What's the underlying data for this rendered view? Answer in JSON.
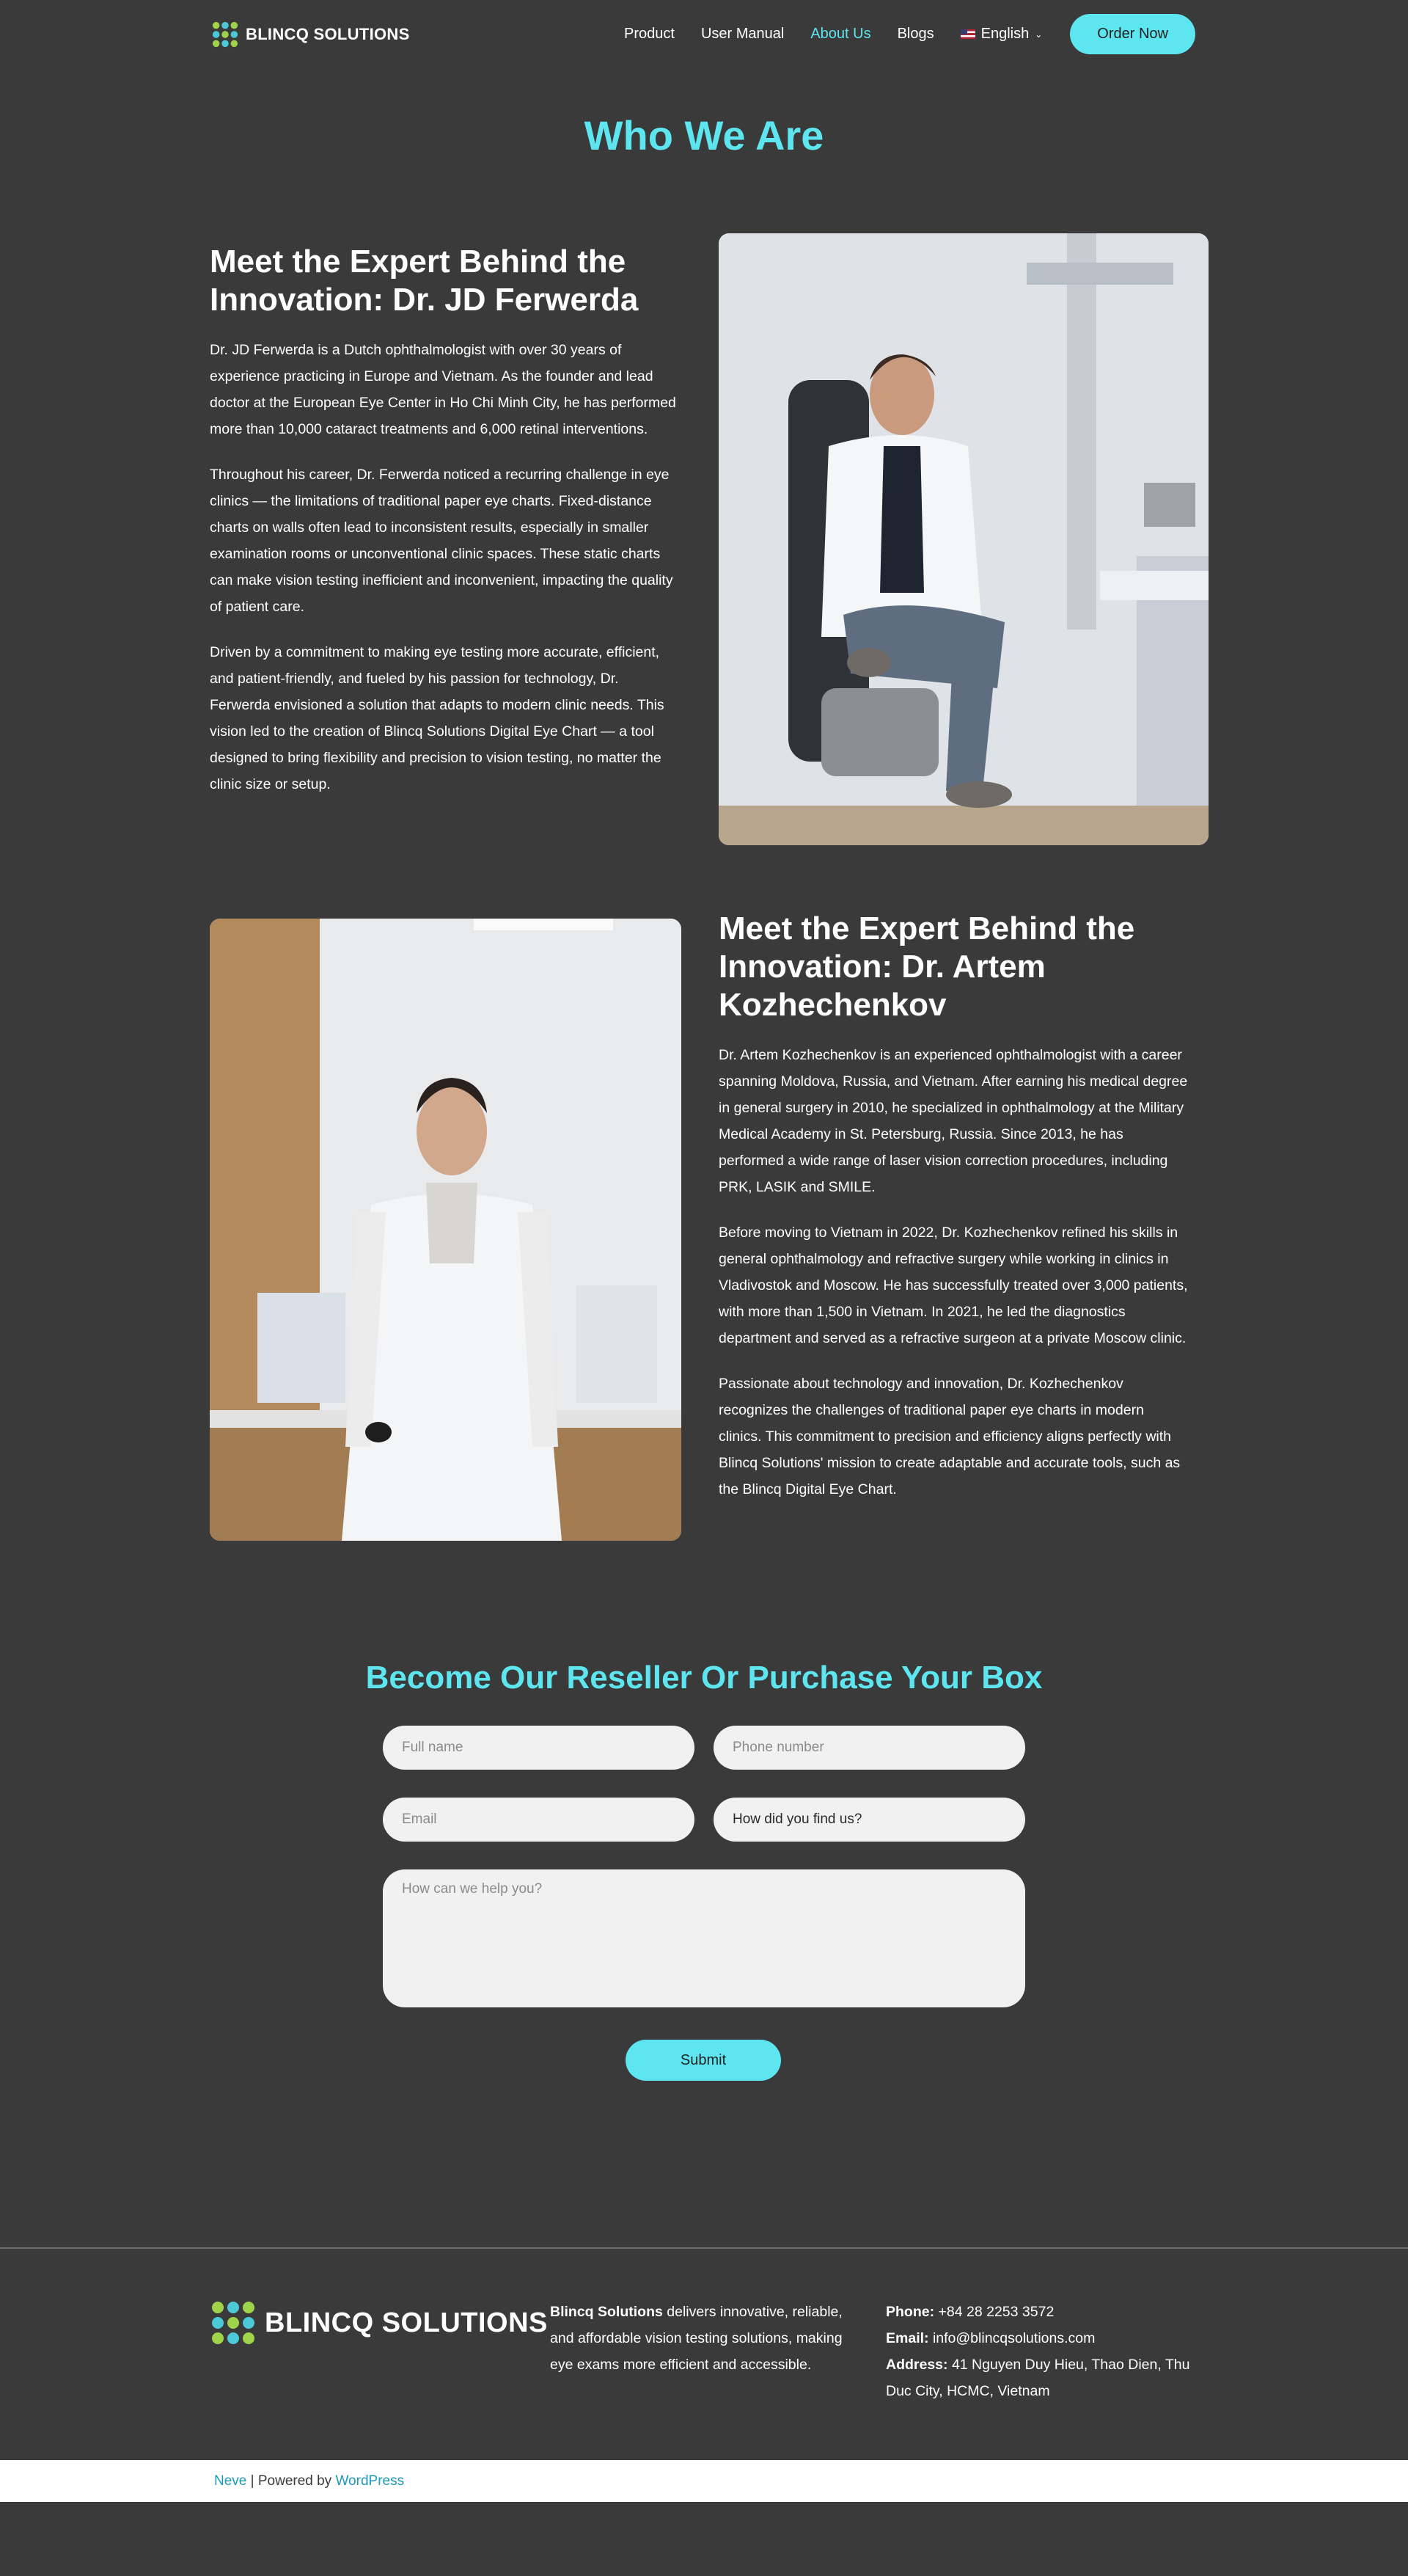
{
  "header": {
    "logo_text": "BLINCQ SOLUTIONS",
    "nav": [
      {
        "label": "Product"
      },
      {
        "label": "User Manual"
      },
      {
        "label": "About Us"
      },
      {
        "label": "Blogs"
      }
    ],
    "language": "English",
    "order_button": "Order Now"
  },
  "page_title": "Who We Are",
  "expert1": {
    "title": "Meet the Expert Behind the Innovation:  Dr. JD Ferwerda",
    "paragraphs": [
      "Dr. JD Ferwerda is a Dutch ophthalmologist with over 30 years of experience practicing in Europe and Vietnam. As the founder and lead doctor at the European Eye Center in Ho Chi Minh City, he has performed more than 10,000 cataract treatments and 6,000 retinal interventions.",
      "Throughout his career, Dr. Ferwerda noticed a recurring challenge in eye clinics — the limitations of traditional paper eye charts. Fixed-distance charts on walls often lead to inconsistent results, especially in smaller examination rooms or unconventional clinic spaces. These static charts can make vision testing inefficient and inconvenient, impacting the quality of patient care.",
      "Driven by a commitment to making eye testing more accurate, efficient, and patient-friendly, and fueled by his passion for technology, Dr. Ferwerda envisioned a solution that adapts to modern clinic needs. This vision led to the creation of Blincq Solutions Digital Eye Chart — a tool designed to bring flexibility and precision to vision testing, no matter the clinic size or setup."
    ]
  },
  "expert2": {
    "title": "Meet the Expert Behind the Innovation:  Dr. Artem Kozhechenkov",
    "paragraphs": [
      "Dr. Artem Kozhechenkov is an experienced ophthalmologist with a career spanning Moldova, Russia, and Vietnam. After earning his medical degree in general surgery in 2010, he specialized in ophthalmology at the Military Medical Academy in St. Petersburg, Russia. Since 2013, he has performed a wide range of laser vision correction procedures, including PRK, LASIK and SMILE.",
      "Before moving to Vietnam in 2022, Dr. Kozhechenkov refined his skills in general ophthalmology and refractive surgery while working in clinics in Vladivostok and Moscow. He has successfully treated over 3,000 patients, with more than 1,500 in Vietnam. In 2021, he led the diagnostics department and served as a refractive surgeon at a private Moscow clinic.",
      "Passionate about technology and innovation, Dr. Kozhechenkov recognizes the challenges of traditional paper eye charts in modern clinics. This commitment to precision and efficiency aligns perfectly with Blincq Solutions' mission to create adaptable and accurate tools, such as the Blincq Digital Eye Chart."
    ]
  },
  "reseller": {
    "title": "Become Our Reseller Or Purchase Your Box",
    "full_name_placeholder": "Full name",
    "phone_placeholder": "Phone number",
    "email_placeholder": "Email",
    "find_us_value": "How did you find us?",
    "help_placeholder": "How can we help you?",
    "submit_label": "Submit"
  },
  "footer": {
    "logo_text": "BLINCQ SOLUTIONS",
    "about_strong": "Blincq Solutions",
    "about_text": " delivers innovative, reliable, and affordable vision testing solutions, making eye exams more efficient and accessible.",
    "phone_label": "Phone:",
    "phone_value": " +84 28 2253 3572",
    "email_label": "Email:",
    "email_value": " info@blincqsolutions.com",
    "address_label": "Address:",
    "address_value": " 41 Nguyen Duy Hieu, Thao Dien, Thu Duc City, HCMC, Vietnam"
  },
  "bottom_bar": {
    "theme_link": "Neve",
    "separator": " | Powered by ",
    "wp_link": "WordPress"
  },
  "colors": {
    "background": "#3a3a3a",
    "accent": "#5ee6f0",
    "logo_green": "#9fd44a",
    "logo_teal": "#4cc9d6"
  }
}
